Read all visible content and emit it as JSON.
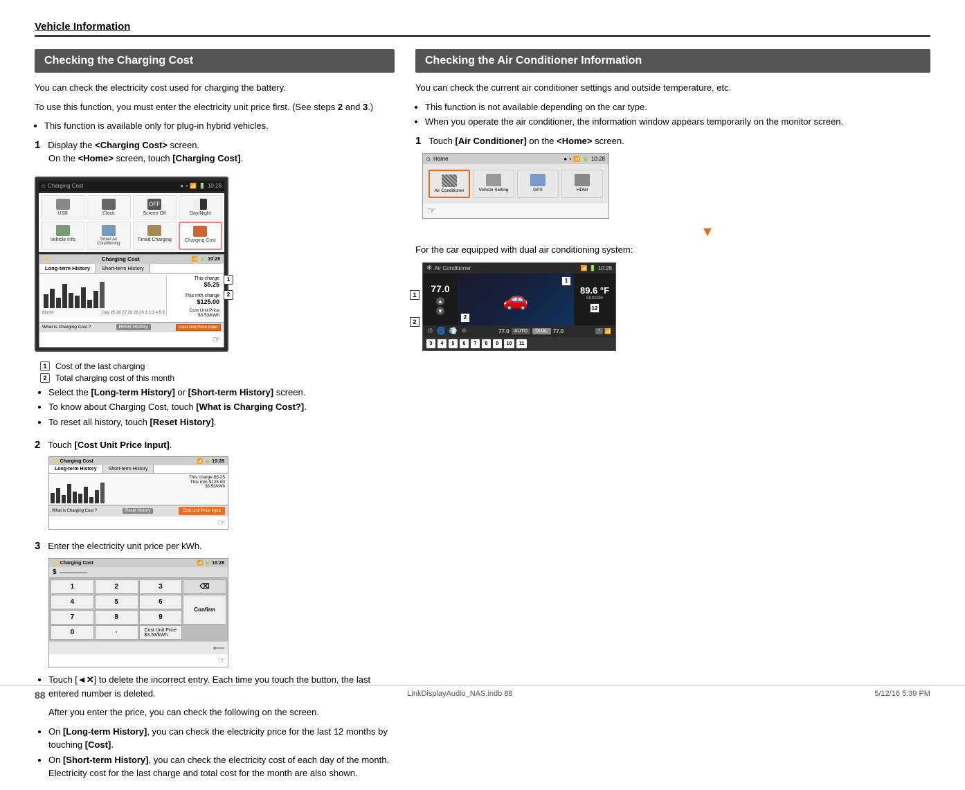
{
  "page": {
    "section_title": "Vehicle Information",
    "page_number": "88",
    "footer_left": "LinkDisplayAudio_NAS.indb   88",
    "footer_right": "5/12/16   5:39 PM"
  },
  "left_section": {
    "box_title": "Checking the Charging Cost",
    "intro1": "You can check the electricity cost used for charging the battery.",
    "intro2": "To use this function, you must enter the electricity unit price first. (See steps ",
    "intro2_bold1": "2",
    "intro2_and": " and ",
    "intro2_bold2": "3",
    "intro2_end": ".)",
    "bullet1": "This function is available only for plug-in hybrid vehicles.",
    "step1_num": "1",
    "step1_text": "Display the ",
    "step1_bold": "<Charging Cost>",
    "step1_text2": " screen.",
    "step1_sub": "On the ",
    "step1_sub_bold": "<Home>",
    "step1_sub2": " screen, touch ",
    "step1_sub_bold2": "[Charging Cost]",
    "step1_sub3": ".",
    "home_screen_label": "Home",
    "home_icons": [
      "USB",
      "Clock",
      "Screen Off",
      "Day/Night",
      "Vehicle Info",
      "Timed Air\nConditioning",
      "Timed Charging",
      "Charging Cost"
    ],
    "badge1": "1",
    "badge1_text": "Cost of the last charging",
    "badge2": "2",
    "badge2_text": "Total charging cost of this month",
    "bullet2": "Select the ",
    "bullet2_bold": "[Long-term History]",
    "bullet2_or": " or ",
    "bullet2_bold2": "[Short-term History]",
    "bullet2_end": " screen.",
    "bullet3": "To know about Charging Cost, touch ",
    "bullet3_bold": "[What is Charging Cost?]",
    "bullet3_end": ".",
    "bullet4": "To reset all history, touch ",
    "bullet4_bold": "[Reset History]",
    "bullet4_end": ".",
    "step2_num": "2",
    "step2_text": "Touch ",
    "step2_bold": "[Cost Unit Price Input]",
    "step2_end": ".",
    "step3_num": "3",
    "step3_text": "Enter the electricity unit price per kWh.",
    "kbd_value": "3.53",
    "kbd_unit": "/kWh",
    "touch_note": "Touch [",
    "touch_icon": "◄✕",
    "touch_note2": "] to delete the incorrect entry. Each time you touch the button, the last entered number is deleted.",
    "after_enter_text": "After you enter the price, you can check the following on the screen.",
    "on_long_text": "On ",
    "on_long_bold": "[Long-term History]",
    "on_long_end": ", you can check the electricity price for the last 12 months by touching ",
    "on_long_bold2": "[Cost]",
    "on_long_end2": ".",
    "on_short_text": "On ",
    "on_short_bold": "[Short-term History]",
    "on_short_end": ", you can check the electricity cost of each day of the month. Electricity cost for the last charge and total cost for the month are also shown."
  },
  "right_section": {
    "box_title": "Checking the Air Conditioner Information",
    "intro1": "You can check the current air conditioner settings and outside temperature, etc.",
    "bullet1": "This function is not available depending on the car type.",
    "bullet2": "When you operate the air conditioner, the information window appears temporarily on the monitor screen.",
    "step1_num": "1",
    "step1_text": "Touch ",
    "step1_bold": "[Air Conditioner]",
    "step1_text2": " on the ",
    "step1_bold2": "<Home>",
    "step1_text3": " screen.",
    "dual_text": "For the car equipped with dual air conditioning system:",
    "ac_home_items": [
      "Air Conditioner",
      "Vehicle Setting",
      "GPS",
      "HDMI"
    ],
    "temp_outside": "89.6 °F",
    "temp_outside_label": "Outside",
    "badge_nums": [
      "1",
      "2",
      "3",
      "4",
      "5",
      "6",
      "7",
      "8",
      "9",
      "10",
      "11",
      "12"
    ]
  },
  "screen_data": {
    "charging_cost_title": "Charging Cost",
    "long_term": "Long-term History",
    "short_term": "Short-term History",
    "this_charge": "This charge",
    "this_charge_val": "$5.25",
    "this_mth": "This mth charge",
    "this_mth_val": "$125.00",
    "cost_unit": "Cost Unit Price",
    "cost_unit_val": "$3.53/kWh",
    "what_is": "What is Charging Cost ?",
    "reset_history": "Reset History",
    "cost_unit_input": "Cost Unit Price Input",
    "time": "10:28",
    "confirm": "Confirm",
    "cost_unit_price": "Cost Unit Price\n$3.53/kWh"
  }
}
